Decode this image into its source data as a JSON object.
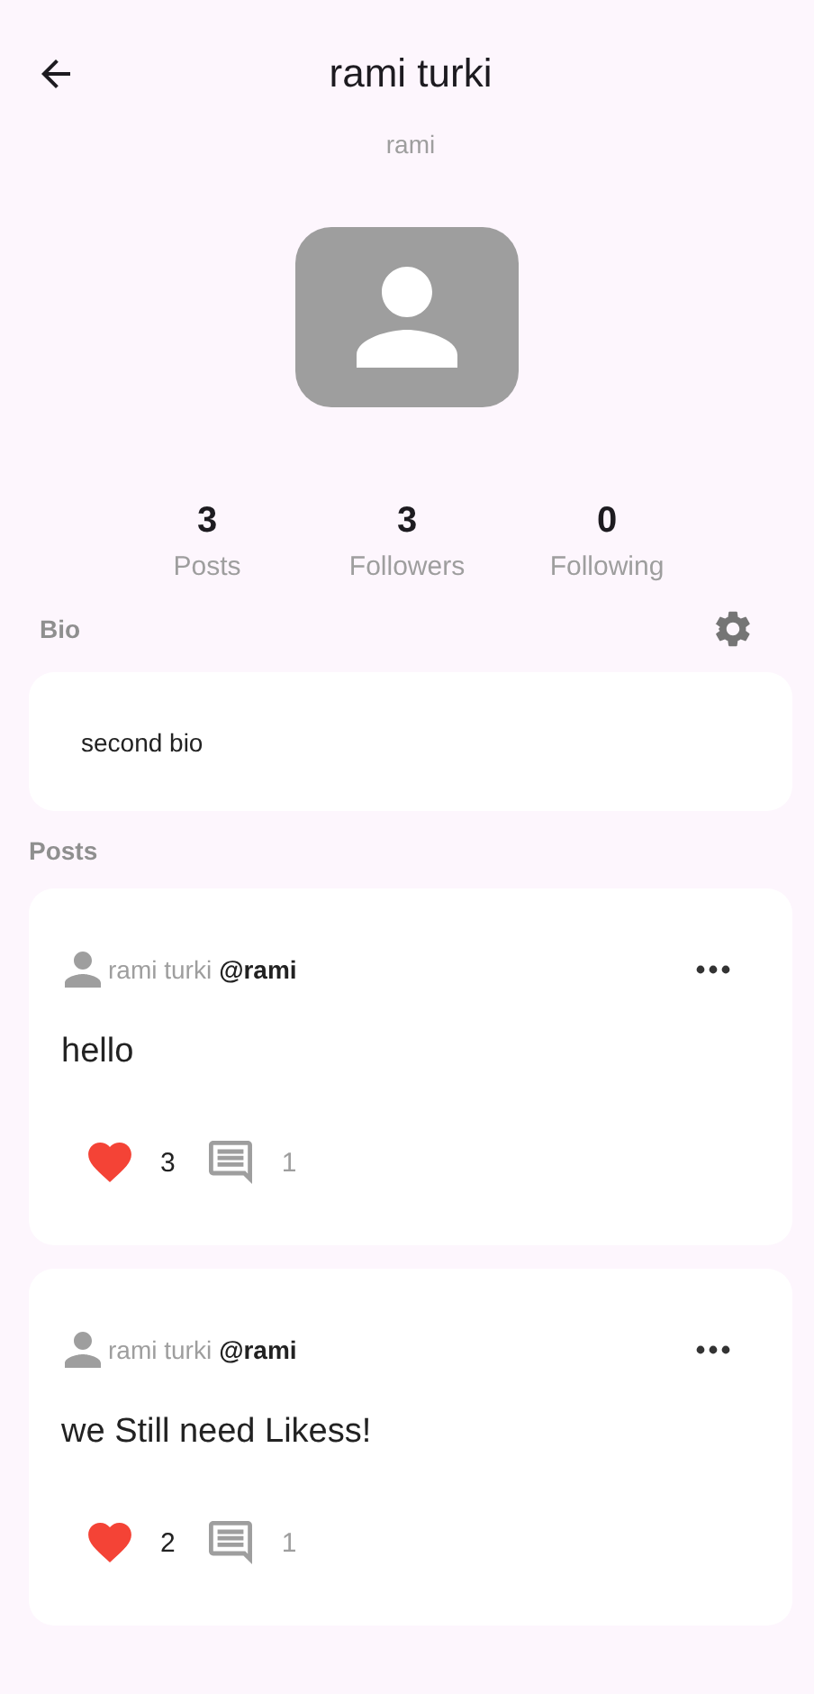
{
  "app_bar": {
    "title": "rami turki"
  },
  "username": "rami",
  "stats": [
    {
      "value": "3",
      "label": "Posts"
    },
    {
      "value": "3",
      "label": "Followers"
    },
    {
      "value": "0",
      "label": "Following"
    }
  ],
  "bio": {
    "label": "Bio",
    "text": "second bio"
  },
  "posts_label": "Posts",
  "posts": [
    {
      "author": "rami turki",
      "handle": "@rami",
      "text": "hello",
      "liked": true,
      "likes": "3",
      "comments": "1"
    },
    {
      "author": "rami turki",
      "handle": "@rami",
      "text": "we Still need Likess!",
      "liked": true,
      "likes": "2",
      "comments": "1"
    }
  ]
}
